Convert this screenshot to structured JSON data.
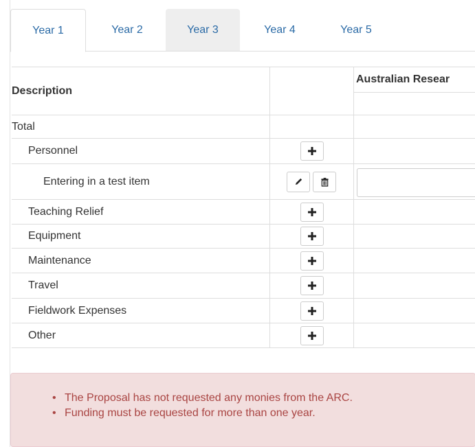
{
  "tabs": [
    {
      "label": "Year 1",
      "state": "active"
    },
    {
      "label": "Year 2",
      "state": "normal"
    },
    {
      "label": "Year 3",
      "state": "hover"
    },
    {
      "label": "Year 4",
      "state": "normal"
    },
    {
      "label": "Year 5",
      "state": "normal"
    }
  ],
  "table": {
    "description_header": "Description",
    "funder_header": "Australian Resear",
    "rows": [
      {
        "label": "Total"
      },
      {
        "label": "Personnel"
      },
      {
        "label": "Entering in a test item"
      },
      {
        "label": "Teaching Relief"
      },
      {
        "label": "Equipment"
      },
      {
        "label": "Maintenance"
      },
      {
        "label": "Travel"
      },
      {
        "label": "Fieldwork Expenses"
      },
      {
        "label": "Other"
      }
    ]
  },
  "alert": {
    "bullet": "•",
    "messages": [
      "The Proposal has not requested any monies from the ARC.",
      "Funding must be requested for more than one year."
    ]
  },
  "colors": {
    "link": "#2a6aa6",
    "alert_bg": "#f2dede",
    "alert_text": "#a94442",
    "border": "#dddddd"
  }
}
